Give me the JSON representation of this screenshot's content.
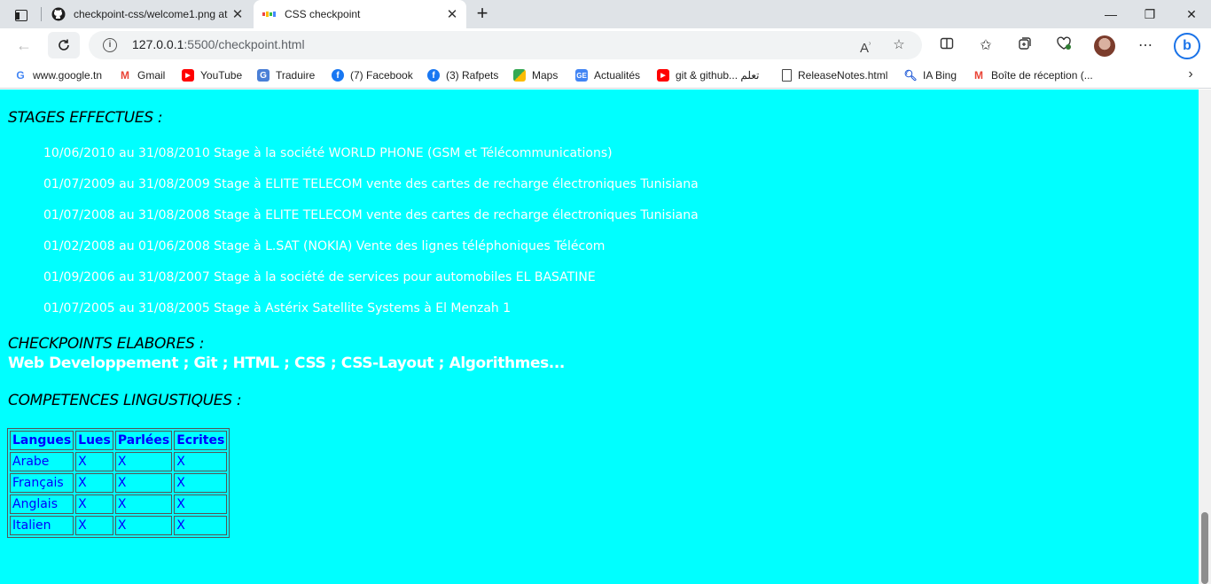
{
  "browser": {
    "tabs": [
      {
        "title": "checkpoint-css/welcome1.png at",
        "icon": "github-icon",
        "active": false
      },
      {
        "title": "CSS checkpoint",
        "icon": "page-favicon",
        "active": true
      }
    ],
    "address": {
      "host": "127.0.0.1",
      "rest": ":5500/checkpoint.html"
    },
    "bookmarks": [
      {
        "label": "www.google.tn",
        "icon": "google-icon",
        "color": "#4285f4"
      },
      {
        "label": "Gmail",
        "icon": "gmail-icon",
        "color": "#ea4335"
      },
      {
        "label": "YouTube",
        "icon": "youtube-icon",
        "color": "#ff0000"
      },
      {
        "label": "Traduire",
        "icon": "translate-icon",
        "color": "#4a7fd6"
      },
      {
        "label": "(7) Facebook",
        "icon": "facebook-icon",
        "color": "#1877f2"
      },
      {
        "label": "(3) Rafpets",
        "icon": "facebook-icon",
        "color": "#1877f2"
      },
      {
        "label": "Maps",
        "icon": "maps-icon",
        "color": "#34a853"
      },
      {
        "label": "Actualités",
        "icon": "news-icon",
        "color": "#4285f4"
      },
      {
        "label": "git & github... تعلم",
        "icon": "youtube-icon",
        "color": "#ff0000"
      },
      {
        "label": "ReleaseNotes.html",
        "icon": "file-icon",
        "color": "#ffffff"
      },
      {
        "label": "IA Bing",
        "icon": "search-icon",
        "color": "#ffffff"
      },
      {
        "label": "Boîte de réception (...",
        "icon": "gmail-icon",
        "color": "#ea4335"
      }
    ]
  },
  "page": {
    "background": "#00ffff",
    "stages_heading": "STAGES EFFECTUES :",
    "stages": [
      "10/06/2010 au 31/08/2010 Stage à la société WORLD PHONE (GSM et Télécommunications)",
      "01/07/2009 au 31/08/2009 Stage à ELITE TELECOM vente des cartes de recharge électroniques Tunisiana",
      "01/07/2008 au 31/08/2008 Stage à ELITE TELECOM vente des cartes de recharge électroniques Tunisiana",
      "01/02/2008 au 01/06/2008 Stage à L.SAT (NOKIA) Vente des lignes téléphoniques Télécom",
      "01/09/2006 au 31/08/2007 Stage à la société de services pour automobiles EL BASATINE",
      "01/07/2005 au 31/08/2005 Stage à Astérix Satellite Systems à El Menzah 1"
    ],
    "checkpoints_heading": "CHECKPOINTS ELABORES :",
    "checkpoints_list": "Web Developpement ; Git ; HTML ; CSS ; CSS-Layout ; Algorithmes...",
    "languages_heading": "COMPETENCES LINGUSTIQUES :",
    "languages_table": {
      "headers": [
        "Langues",
        "Lues",
        "Parlées",
        "Ecrites"
      ],
      "rows": [
        [
          "Arabe",
          "X",
          "X",
          "X"
        ],
        [
          "Français",
          "X",
          "X",
          "X"
        ],
        [
          "Anglais",
          "X",
          "X",
          "X"
        ],
        [
          "Italien",
          "X",
          "X",
          "X"
        ]
      ]
    }
  }
}
